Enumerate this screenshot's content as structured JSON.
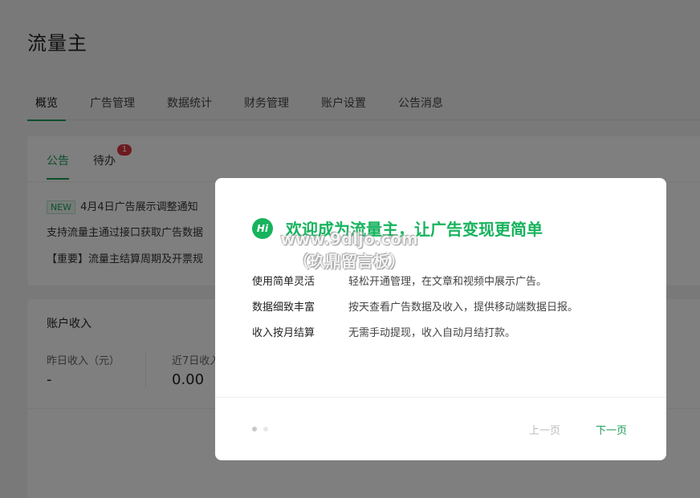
{
  "page_title": "流量主",
  "main_tabs": [
    {
      "label": "概览"
    },
    {
      "label": "广告管理"
    },
    {
      "label": "数据统计"
    },
    {
      "label": "财务管理"
    },
    {
      "label": "账户设置"
    },
    {
      "label": "公告消息"
    }
  ],
  "announcement_card": {
    "tabs": [
      {
        "label": "公告"
      },
      {
        "label": "待办",
        "badge": "1"
      }
    ],
    "notices": [
      {
        "tag": "NEW",
        "text": "4月4日广告展示调整通知"
      },
      {
        "text": "支持流量主通过接口获取广告数据"
      },
      {
        "text": "【重要】流量主结算周期及开票规"
      }
    ]
  },
  "income_card": {
    "title": "账户收入",
    "stats": [
      {
        "label": "昨日收入（元）",
        "value": "-"
      },
      {
        "label": "近7日收入",
        "value": "0.00"
      }
    ]
  },
  "modal": {
    "icon_text": "Hi",
    "title": "欢迎成为流量主，让广告变现更简单",
    "watermark_line1": "www.9dljo.com",
    "watermark_line2": "（玖鼎留言板）",
    "features": [
      {
        "name": "使用简单灵活",
        "desc": "轻松开通管理，在文章和视频中展示广告。"
      },
      {
        "name": "数据细致丰富",
        "desc": "按天查看广告数据及收入，提供移动端数据日报。"
      },
      {
        "name": "收入按月结算",
        "desc": "无需手动提现，收入自动月结打款。"
      }
    ],
    "prev_label": "上一页",
    "next_label": "下一页"
  },
  "colors": {
    "accent": "#1a9f57",
    "title_green": "#17b35e",
    "badge_red": "#d9363e"
  }
}
